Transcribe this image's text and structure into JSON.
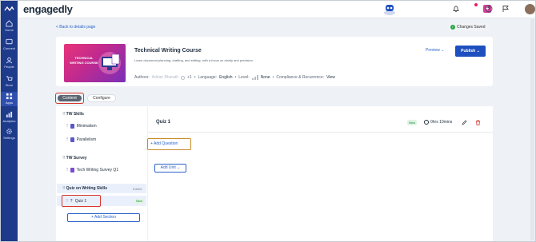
{
  "app": {
    "brand": "engagedly"
  },
  "nav": {
    "items": [
      {
        "label": "Home"
      },
      {
        "label": "Connect"
      },
      {
        "label": "People"
      },
      {
        "label": "Store"
      },
      {
        "label": "Apps"
      },
      {
        "label": "Analytics"
      },
      {
        "label": "Settings"
      }
    ]
  },
  "header": {
    "back_label": "< Back to details page",
    "saved_label": "Changes Saved"
  },
  "course": {
    "title": "Technical Writing Course",
    "description": "Learn document planning, drafting, and editing, with a focus on clarity and precision.",
    "thumbnail_text": "TECHNICAL WRITING COURSE",
    "authors_label": "Authors:",
    "author_name": "Adrian Bharath",
    "author_extra": "+1",
    "language_label": "Language:",
    "language_value": "English",
    "level_label": "Level:",
    "level_value": "None",
    "compliance_label": "Compliance & Recurrence:",
    "compliance_value": "View",
    "preview_label": "Preview",
    "publish_label": "Publish"
  },
  "tabs": {
    "content": "Content",
    "configure": "Configure"
  },
  "outline": {
    "sections": [
      {
        "title": "TW Skills",
        "items": [
          "Minimalism",
          "Parallelism"
        ]
      },
      {
        "title": "TW Survey",
        "items": [
          "Tech Writing Survey Q1"
        ]
      },
      {
        "title": "Quiz on Writing Skills",
        "status": "Edited",
        "items": [
          "Quiz 1"
        ],
        "item_tag": "New"
      }
    ],
    "add_section_label": "+ Add Section"
  },
  "editor": {
    "title": "Quiz 1",
    "tag": "New",
    "duration": "0hrs 10mins",
    "add_question_label": "+ Add Question",
    "add_unit_label": "Add Unit"
  },
  "colors": {
    "nav_bg": "#1e3a8a",
    "accent": "#1d4fbf",
    "highlight": "#d9342b"
  }
}
